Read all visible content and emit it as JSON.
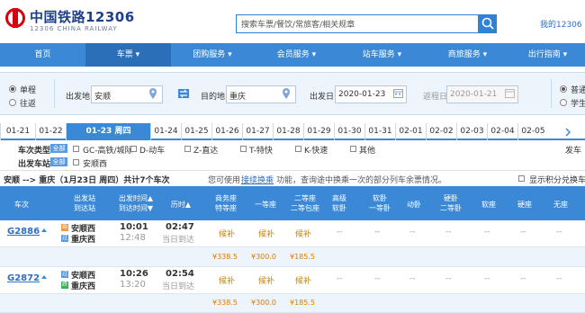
{
  "header": {
    "logo_title": "中国铁路12306",
    "logo_sub": "12306 CHINA RAILWAY",
    "search_placeholder": "搜索车票/餐饮/常旅客/相关规章",
    "my_account": "我的12306"
  },
  "nav": [
    "首页",
    "车票 ▾",
    "团购服务 ▾",
    "会员服务 ▾",
    "站车服务 ▾",
    "商旅服务 ▾",
    "出行指南 ▾"
  ],
  "query": {
    "single": "单程",
    "round": "往返",
    "from_label": "出发地",
    "from_value": "安顺",
    "to_label": "目的地",
    "to_value": "重庆",
    "depart_label": "出发日",
    "depart_value": "2020-01-23",
    "return_label": "返程日",
    "return_value": "2020-01-21",
    "normal": "普通",
    "student": "学生"
  },
  "dates": [
    "01-21",
    "01-22",
    "01-23 周四",
    "01-24",
    "01-25",
    "01-26",
    "01-27",
    "01-28",
    "01-29",
    "01-30",
    "01-31",
    "02-01",
    "02-02",
    "02-03",
    "02-04",
    "02-05"
  ],
  "filters": {
    "type_label": "车次类型",
    "station_label": "出发车站",
    "all": "全部",
    "types": [
      "GC-高铁/城际",
      "D-动车",
      "Z-直达",
      "T-特快",
      "K-快速",
      "其他"
    ],
    "station": "安顺西",
    "right_label": "发车"
  },
  "summary": {
    "route": "安顺 --> 重庆（1月23日 周四）共计7个车次",
    "tip_prefix": "您可使用",
    "tip_link": "接续换乘",
    "tip_suffix": "功能，查询途中换乘一次的部分列车余票情况。",
    "show_points": "显示积分兑换车"
  },
  "table": {
    "headers": [
      "车次",
      "出发站\n到达站",
      "出发时间▲\n到达时间▼",
      "历时▲",
      "商务座\n特等座",
      "一等座",
      "二等座\n二等包座",
      "高级\n软卧",
      "软卧\n一等卧",
      "动卧",
      "硬卧\n二等卧",
      "软座",
      "硬座",
      "无座"
    ],
    "rows": [
      {
        "train": "G2886",
        "from": "安顺西",
        "to": "重庆西",
        "dep": "10:01",
        "arr": "12:48",
        "dur": "02:47",
        "arrive_day": "当日到达",
        "seats": [
          "候补",
          "候补",
          "候补",
          "--",
          "--",
          "--",
          "--",
          "--",
          "--",
          "--"
        ],
        "prices": [
          "¥338.5",
          "¥300.0",
          "¥185.5"
        ]
      },
      {
        "train": "G2872",
        "from": "安顺西",
        "to": "重庆西",
        "dep": "10:26",
        "arr": "13:20",
        "dur": "02:54",
        "arrive_day": "当日到达",
        "seats": [
          "候补",
          "候补",
          "候补",
          "--",
          "--",
          "--",
          "--",
          "--",
          "--",
          "--"
        ],
        "prices": [
          "¥338.5",
          "¥300.0",
          "¥185.5"
        ]
      }
    ]
  },
  "colors": {
    "brand_blue": "#3b89d6",
    "logo_red": "#d7000f",
    "avail": "#c2860c",
    "price": "#e07a00"
  }
}
